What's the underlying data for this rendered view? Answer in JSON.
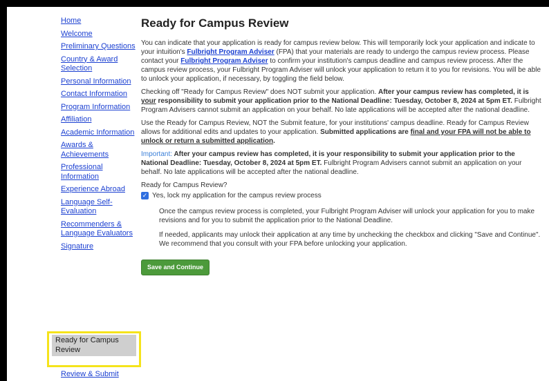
{
  "sidebar": {
    "items": [
      {
        "label": "Home"
      },
      {
        "label": "Welcome"
      },
      {
        "label": "Preliminary Questions"
      },
      {
        "label": "Country & Award Selection"
      },
      {
        "label": "Personal Information"
      },
      {
        "label": "Contact Information"
      },
      {
        "label": "Program Information"
      },
      {
        "label": "Affiliation"
      },
      {
        "label": "Academic Information"
      },
      {
        "label": "Awards & Achievements"
      },
      {
        "label": "Professional Information"
      },
      {
        "label": "Experience Abroad"
      },
      {
        "label": "Language Self-Evaluation"
      },
      {
        "label": "Recommenders & Language Evaluators"
      },
      {
        "label": "Signature"
      }
    ],
    "active": {
      "label": "Ready for Campus Review"
    },
    "last": {
      "label": "Review & Submit"
    }
  },
  "main": {
    "title": "Ready for Campus Review",
    "p1": {
      "a": "You can indicate that your application is ready for campus review below. This will temporarily lock your application and indicate to your intuition's ",
      "link1": "Fulbright Program Adviser",
      "b": " (FPA) that your materials are ready to undergo the campus review process. Please contact your ",
      "link2": "Fulbright Program Adviser",
      "c": " to confirm your institution's campus deadline and campus review process. After the campus review process, your Fulbright Program Adviser will unlock your application to return it to you for revisions. You will be able to unlock your application, if necessary, by toggling the field below."
    },
    "p2": {
      "a": "Checking off \"Ready for Campus Review\" does NOT submit your application. ",
      "bold1": "After your campus review has completed, it is ",
      "bold_u": "your",
      "bold2": " responsibility to submit your application prior to the National Deadline: Tuesday, October 8, 2024 at 5pm ET.",
      "b": " Fulbright Program Advisers cannot submit an application on your behalf.  No late applications will be accepted after the national deadline."
    },
    "p3": {
      "a": "Use the Ready for Campus Review, NOT the Submit feature, for your institutions' campus deadline. Ready for Campus Review allows for additional edits and updates to your application. ",
      "bold1": "Submitted applications are ",
      "bold_u": "final and your FPA will not be able to unlock or return a submitted application",
      "end": "."
    },
    "p4": {
      "label": "Important:",
      "bold": " After your campus review has completed, it is your responsibility to submit your application prior to the National Deadline: Tuesday, October 8, 2024 at 5pm ET.",
      "b": " Fulbright Program Advisers cannot submit an application on your behalf. No late applications will be accepted after the national deadline."
    },
    "question": "Ready for Campus Review?",
    "checkbox_label": "Yes, lock my application for the campus review process",
    "checkbox_checked": true,
    "note1": "Once the campus review process is completed, your Fulbright Program Adviser will unlock your application for you to make revisions and for you to submit the application prior to the National Deadline.",
    "note2": "If needed, applicants may unlock their application at any time by unchecking the checkbox and clicking \"Save and Continue\". We recommend that you consult with your FPA before unlocking your application.",
    "save_label": "Save and Continue"
  },
  "colors": {
    "link": "#1a3fd1",
    "highlight": "#f5e31b",
    "active_bg": "#cfcfcf",
    "button": "#4c9a3b",
    "checkbox": "#2f6fe0"
  }
}
